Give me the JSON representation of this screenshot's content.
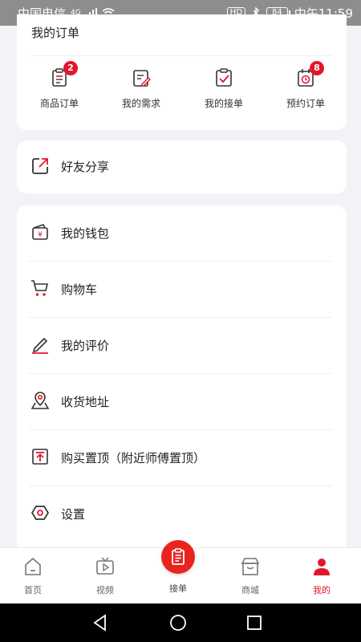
{
  "status_bar": {
    "carrier": "中国电信",
    "signal": "4G",
    "hd": "HD",
    "battery": "84",
    "time": "中午11:59"
  },
  "orders": {
    "title": "我的订单",
    "items": [
      {
        "label": "商品订单",
        "badge": "2",
        "icon": "product-order-icon"
      },
      {
        "label": "我的需求",
        "badge": "",
        "icon": "my-demand-icon"
      },
      {
        "label": "我的接单",
        "badge": "",
        "icon": "my-accepted-icon"
      },
      {
        "label": "预约订单",
        "badge": "8",
        "icon": "appointment-icon"
      }
    ]
  },
  "share": {
    "label": "好友分享",
    "icon": "share-icon"
  },
  "menu": {
    "items": [
      {
        "label": "我的钱包",
        "icon": "wallet-icon"
      },
      {
        "label": "购物车",
        "icon": "cart-icon"
      },
      {
        "label": "我的评价",
        "icon": "pen-icon"
      },
      {
        "label": "收货地址",
        "icon": "location-icon"
      },
      {
        "label": "购买置顶（附近师傅置顶）",
        "icon": "pin-top-icon"
      },
      {
        "label": "设置",
        "icon": "settings-icon"
      }
    ]
  },
  "tabbar": {
    "tabs": [
      {
        "label": "首页",
        "icon": "home-icon"
      },
      {
        "label": "视频",
        "icon": "video-icon"
      },
      {
        "label": "接单",
        "icon": "accept-order-icon"
      },
      {
        "label": "商城",
        "icon": "store-icon"
      },
      {
        "label": "我的",
        "icon": "profile-icon"
      }
    ],
    "active": "我的"
  },
  "colors": {
    "accent": "#e3162a",
    "background": "#f3f2f7",
    "card": "#ffffff"
  }
}
